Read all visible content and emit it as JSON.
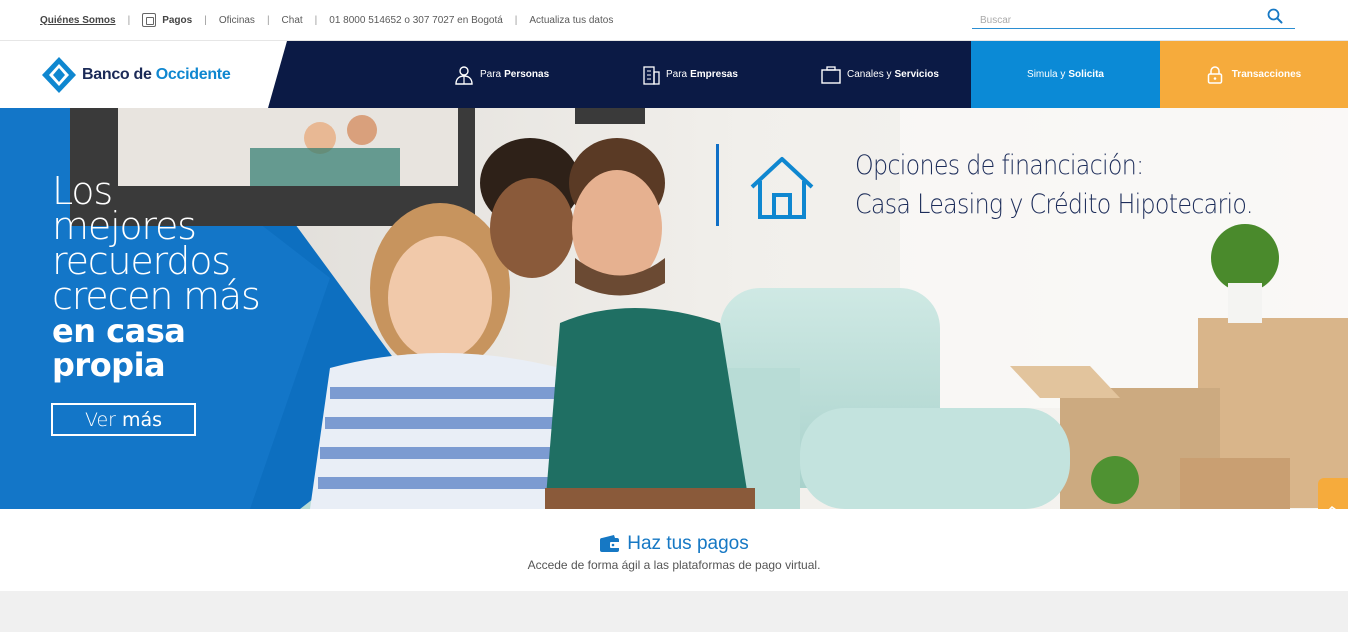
{
  "utility": {
    "links": [
      {
        "label": "Quiénes Somos"
      },
      {
        "label": "Pagos",
        "icon": "pagos-icon"
      },
      {
        "label": "Oficinas"
      },
      {
        "label": "Chat"
      },
      {
        "label": "01 8000 514652 o 307 7027 en Bogotá"
      },
      {
        "label": "Actualiza tus datos"
      }
    ],
    "search_placeholder": "Buscar",
    "search_icon": "search-icon"
  },
  "nav": {
    "logo_text_1": "Banco de ",
    "logo_text_2": "Occidente",
    "personas_pre": "Para",
    "personas_bold": "Personas",
    "empresas_pre": "Para",
    "empresas_bold": "Empresas",
    "canales_pre": "Canales y",
    "canales_bold": "Servicios",
    "simula_pre": "Simula y",
    "simula_bold": "Solicita",
    "transacciones": "Transacciones",
    "colors": {
      "navy": "#0b1a45",
      "blue": "#0b8ad6",
      "orange": "#f6ab3c"
    }
  },
  "hero": {
    "light_text": "Los\nmejores\nrecuerdos\ncrecen más",
    "bold_text": "en casa\npropia",
    "cta_pre": "Ver",
    "cta_bold": "más",
    "promo_line1": "Opciones de financiación:",
    "promo_line2": "Casa Leasing y Crédito Hipotecario.",
    "promo_icon": "house-icon"
  },
  "payments": {
    "title": "Haz tus pagos",
    "subtitle": "Accede de forma ágil a las plataformas de pago virtual.",
    "icon": "wallet-icon"
  }
}
